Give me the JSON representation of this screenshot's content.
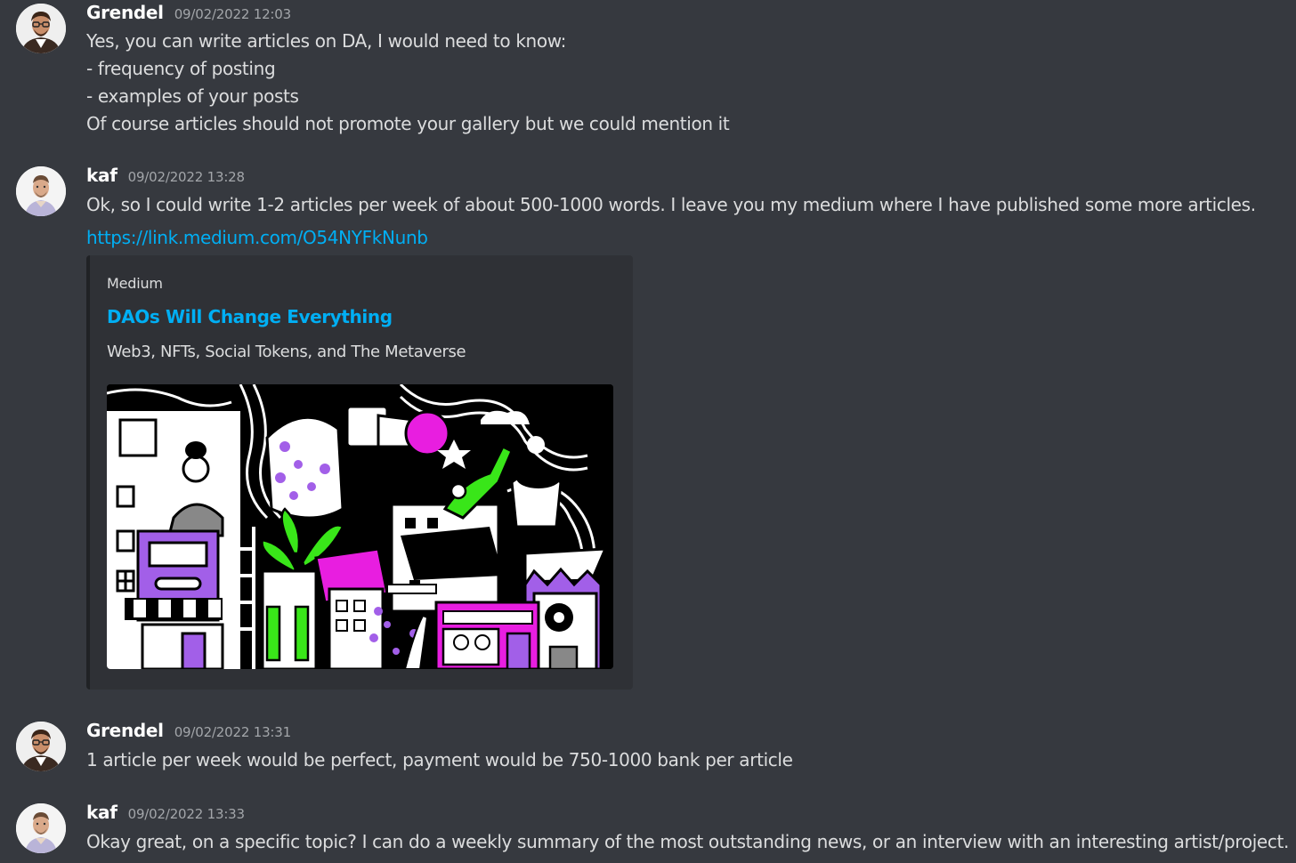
{
  "messages": [
    {
      "author": "Grendel",
      "timestamp": "09/02/2022 12:03",
      "lines": [
        "Yes, you can write articles on DA, I would need to know:",
        "- frequency of posting",
        "- examples of your posts",
        "Of course articles should not promote your gallery but we could mention it"
      ]
    },
    {
      "author": "kaf",
      "timestamp": "09/02/2022 13:28",
      "lines": [
        "Ok, so I could write 1-2 articles per week of about 500-1000 words.  I leave you my medium where I have published some more articles."
      ],
      "link": "https://link.medium.com/O54NYFkNunb",
      "embed": {
        "provider": "Medium",
        "title": "DAOs Will Change Everything",
        "description": "Web3, NFTs, Social Tokens, and The Metaverse",
        "image_icon": "medium-article-illustration"
      }
    },
    {
      "author": "Grendel",
      "timestamp": "09/02/2022 13:31",
      "lines": [
        "1 article per week would be perfect, payment would be 750-1000 bank per article"
      ]
    },
    {
      "author": "kaf",
      "timestamp": "09/02/2022 13:33",
      "lines": [
        "Okay great, on a specific topic?  I can do a weekly summary of the most outstanding news, or an interview with an interesting artist/project."
      ]
    }
  ],
  "colors": {
    "background": "#36393f",
    "embed_background": "#2f3136",
    "embed_border": "#202225",
    "author": "#ffffff",
    "timestamp": "#a3a6aa",
    "text": "#dcddde",
    "link": "#00aff4",
    "accent_magenta": "#e81ee0",
    "accent_green": "#39e619",
    "accent_purple": "#a25fe8"
  }
}
